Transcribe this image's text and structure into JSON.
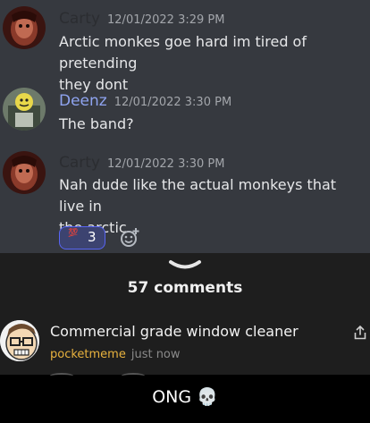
{
  "chat": {
    "messages": [
      {
        "author": "Carty",
        "timestamp": "12/01/2022 3:29 PM",
        "lines": [
          "Arctic monkes goe hard im tired of pretending",
          "they dont"
        ]
      },
      {
        "author": "Deenz",
        "timestamp": "12/01/2022 3:30 PM",
        "lines": [
          "The band?"
        ]
      },
      {
        "author": "Carty",
        "timestamp": "12/01/2022 3:30 PM",
        "lines": [
          "Nah dude like the actual monkeys that live in",
          "the arctic"
        ]
      }
    ],
    "reaction": {
      "emoji": "💯",
      "count": "3"
    }
  },
  "comments": {
    "count_label": "57 comments",
    "items": [
      {
        "text": "Commercial grade window cleaner",
        "user": "pocketmeme",
        "time": "just now"
      }
    ]
  },
  "caption": {
    "text": "ONG 💀"
  },
  "colors": {
    "chat_bg": "#36393f",
    "sheet_bg": "#1e1e1e",
    "username_accent": "#e8b23e",
    "reaction_border": "#5865f2",
    "deenz_name": "#8fa4f0"
  },
  "icons": [
    "chevron-down-icon",
    "add-reaction-icon",
    "share-icon",
    "hundred-points-icon",
    "skull-icon"
  ]
}
